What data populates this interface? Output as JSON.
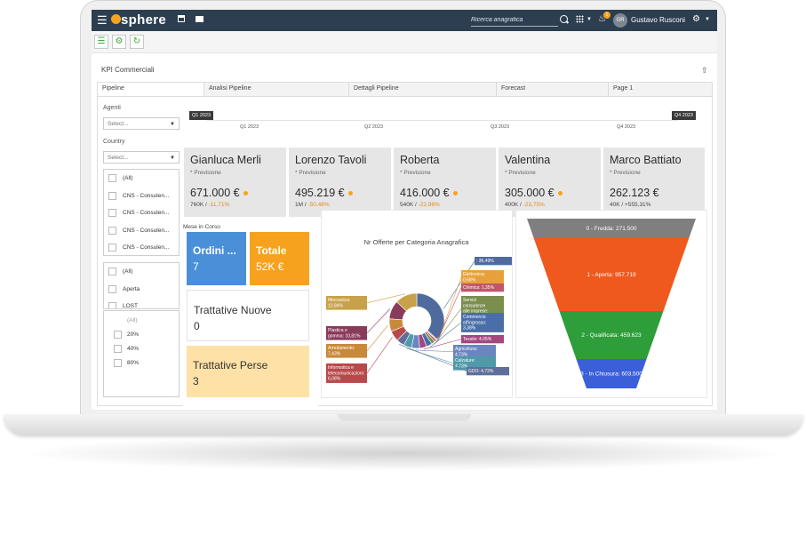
{
  "header": {
    "brand": "sphere",
    "search_placeholder": "Ricerca anagrafica",
    "notification_count": "1",
    "user_initials": "GR",
    "user_name": "Gustavo Rusconi"
  },
  "page": {
    "title": "KPI Commerciali"
  },
  "tabs": [
    {
      "label": "Pipeline",
      "active": true
    },
    {
      "label": "Analisi Pipeline"
    },
    {
      "label": "Dettagli Pipeline"
    },
    {
      "label": "Forecast"
    },
    {
      "label": "Page 1"
    }
  ],
  "filters": {
    "agenti_label": "Agenti",
    "agenti_placeholder": "Select...",
    "country_label": "Country",
    "country_placeholder": "Select...",
    "list1": [
      "(All)",
      "CNS - Consulen...",
      "CNS - Consulen...",
      "CNS - Consulen...",
      "CNS - Consulen..."
    ],
    "list2": [
      "(All)",
      "Aperta",
      "LOST"
    ],
    "list3": [
      "(All)",
      "20%",
      "40%",
      "80%"
    ]
  },
  "timeline": {
    "start_badge": "Q1 2023",
    "end_badge": "Q4 2023",
    "ticks": [
      "Q1 2023",
      "Q2 2023",
      "Q3 2023",
      "Q4 2023"
    ]
  },
  "agents": [
    {
      "name": "Gianluca Merli",
      "subtitle": "* Previsione",
      "value": "671.000 €",
      "target": "760K",
      "sep": " / ",
      "delta": "-11,71%"
    },
    {
      "name": "Lorenzo Tavoli",
      "subtitle": "* Previsione",
      "value": "495.219 €",
      "target": "1M",
      "sep": " / ",
      "delta": "-50,48%"
    },
    {
      "name": "Roberta",
      "subtitle": "* Previsione",
      "value": "416.000 €",
      "target": "540K",
      "sep": " / ",
      "delta": "-22,96%"
    },
    {
      "name": "Valentina",
      "subtitle": "* Previsione",
      "value": "305.000 €",
      "target": "400K",
      "sep": " / ",
      "delta": "-23,75%"
    },
    {
      "name": "Marco Battiato",
      "subtitle": "* Previsione",
      "value": "262.123 €",
      "target": "40K",
      "sep": " / ",
      "delta": "+555,31%"
    }
  ],
  "month": {
    "label": "Mese in Corso",
    "ordini_title": "Ordini ...",
    "ordini_value": "7",
    "totale_title": "Totale",
    "totale_value": "52K €",
    "nuove_title": "Trattative Nuove",
    "nuove_value": "0",
    "perse_title": "Trattative Perse",
    "perse_value": "3"
  },
  "colors": {
    "topbar": "#2d3e50",
    "accent": "#f4a51c",
    "ordini": "#4a90d9",
    "totale": "#f6a21e",
    "perse": "#fde1a6",
    "funnel": [
      "#7f7f7f",
      "#f0591e",
      "#2e9e3a",
      "#3b5fd9"
    ]
  },
  "chart_data": [
    {
      "type": "pie",
      "title": "Nr Offerte per Categoria Anagrafica",
      "slices": [
        {
          "label": ": 36,49%",
          "value": 36.49,
          "color": "#4f6b9e"
        },
        {
          "label": "Elettronica: 0,68%",
          "value": 0.68,
          "color": "#e8a13a"
        },
        {
          "label": "Chimica: 1,35%",
          "value": 1.35,
          "color": "#c0566a"
        },
        {
          "label": "Servizi consulenze alle imprese: 2,03%",
          "value": 2.03,
          "color": "#7a8e4e"
        },
        {
          "label": "Commercio all'ingrosso: 3,38%",
          "value": 3.38,
          "color": "#4a6fa8"
        },
        {
          "label": "Tessile: 4,05%",
          "value": 4.05,
          "color": "#a2487f"
        },
        {
          "label": "Agricoltura: 4,73%",
          "value": 4.73,
          "color": "#6a85c0"
        },
        {
          "label": "Calzature: 4,73%",
          "value": 4.73,
          "color": "#4f9aa8"
        },
        {
          "label": "GDO: 4,73%",
          "value": 4.73,
          "color": "#5f6f99"
        },
        {
          "label": "Informatica e telecomunicazioni: 6,08%",
          "value": 6.08,
          "color": "#b8494a"
        },
        {
          "label": "Arredamento: 7,43%",
          "value": 7.43,
          "color": "#c9893a"
        },
        {
          "label": "Plastica o gomma: 10,81%",
          "value": 10.81,
          "color": "#8a3b5c"
        },
        {
          "label": "Meccanica: 12,84%",
          "value": 12.84,
          "color": "#c8a24a"
        }
      ]
    },
    {
      "type": "funnel",
      "stages": [
        {
          "label": "0 - Fredda: 271.500",
          "value": 271500
        },
        {
          "label": "1 - Aperta: 957.719",
          "value": 957719
        },
        {
          "label": "2 - Qualificata: 459.623",
          "value": 459623
        },
        {
          "label": "3 - In Chiusura: 603.500",
          "value": 603500
        }
      ]
    }
  ]
}
